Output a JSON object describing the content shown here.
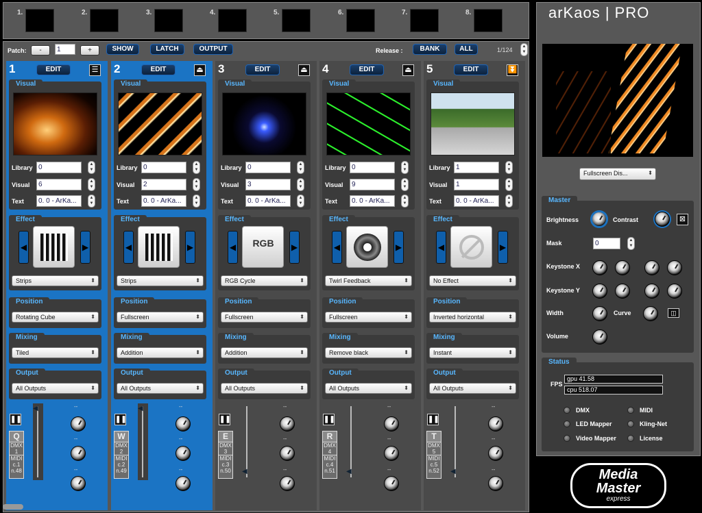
{
  "thumbs": [
    {
      "num": "1."
    },
    {
      "num": "2."
    },
    {
      "num": "3."
    },
    {
      "num": "4."
    },
    {
      "num": "5."
    },
    {
      "num": "6."
    },
    {
      "num": "7."
    },
    {
      "num": "8."
    }
  ],
  "patch": {
    "label": "Patch:",
    "minus": "-",
    "value": "1",
    "plus": "+",
    "show": "SHOW",
    "latch": "LATCH",
    "output": "OUTPUT",
    "release_label": "Release :",
    "bank": "BANK",
    "all": "ALL",
    "page": "1/124"
  },
  "decks": [
    {
      "num": "1",
      "edit": "EDIT",
      "library": "0",
      "visual": "6",
      "text": "0. 0 - ArKa...",
      "effect": "Strips",
      "position": "Rotating Cube",
      "mixing": "Tiled",
      "output": "All Outputs",
      "key": "Q",
      "dmx": "DMX",
      "dmx_ch": "1",
      "midi": "MIDI",
      "midi_c": "c.1",
      "midi_n": "n.48"
    },
    {
      "num": "2",
      "edit": "EDIT",
      "library": "0",
      "visual": "2",
      "text": "0. 0 - ArKa...",
      "effect": "Strips",
      "position": "Fullscreen",
      "mixing": "Addition",
      "output": "All Outputs",
      "key": "W",
      "dmx": "DMX",
      "dmx_ch": "2",
      "midi": "MIDI",
      "midi_c": "c.2",
      "midi_n": "n.49"
    },
    {
      "num": "3",
      "edit": "EDIT",
      "library": "0",
      "visual": "3",
      "text": "0. 0 - ArKa...",
      "effect": "RGB Cycle",
      "position": "Fullscreen",
      "mixing": "Addition",
      "output": "All Outputs",
      "key": "E",
      "dmx": "DMX",
      "dmx_ch": "3",
      "midi": "MIDI",
      "midi_c": "c.3",
      "midi_n": "n.50"
    },
    {
      "num": "4",
      "edit": "EDIT",
      "library": "0",
      "visual": "9",
      "text": "0. 0 - ArKa...",
      "effect": "Twirl Feedback",
      "position": "Fullscreen",
      "mixing": "Remove black",
      "output": "All Outputs",
      "key": "R",
      "dmx": "DMX",
      "dmx_ch": "4",
      "midi": "MIDI",
      "midi_c": "c.4",
      "midi_n": "n.51"
    },
    {
      "num": "5",
      "edit": "EDIT",
      "library": "1",
      "visual": "1",
      "text": "0. 0 - ArKa...",
      "effect": "No Effect",
      "position": "Inverted horizontal",
      "mixing": "Instant",
      "output": "All Outputs",
      "key": "T",
      "dmx": "DMX",
      "dmx_ch": "5",
      "midi": "MIDI",
      "midi_c": "c.5",
      "midi_n": "n.52"
    }
  ],
  "labels": {
    "visual": "Visual",
    "library": "Library",
    "visual_field": "Visual",
    "text": "Text",
    "effect": "Effect",
    "position": "Position",
    "mixing": "Mixing",
    "output": "Output",
    "dash": "--",
    "rgb": "RGB"
  },
  "right": {
    "logo": "arKaos | PRO",
    "display": "Fullscreen Dis...",
    "master": "Master",
    "brightness": "Brightness",
    "contrast": "Contrast",
    "mask": "Mask",
    "mask_value": "0",
    "keystone_x": "Keystone X",
    "keystone_y": "Keystone Y",
    "width": "Width",
    "curve": "Curve",
    "volume": "Volume",
    "status": "Status",
    "fps": "FPS",
    "gpu": "gpu 41.58",
    "cpu": "cpu 518.07",
    "dmx": "DMX",
    "midi": "MIDI",
    "led_mapper": "LED Mapper",
    "kling_net": "Kling-Net",
    "video_mapper": "Video Mapper",
    "license": "License",
    "brand_top": "Media",
    "brand_mid": "Master",
    "brand_bot": "express"
  }
}
